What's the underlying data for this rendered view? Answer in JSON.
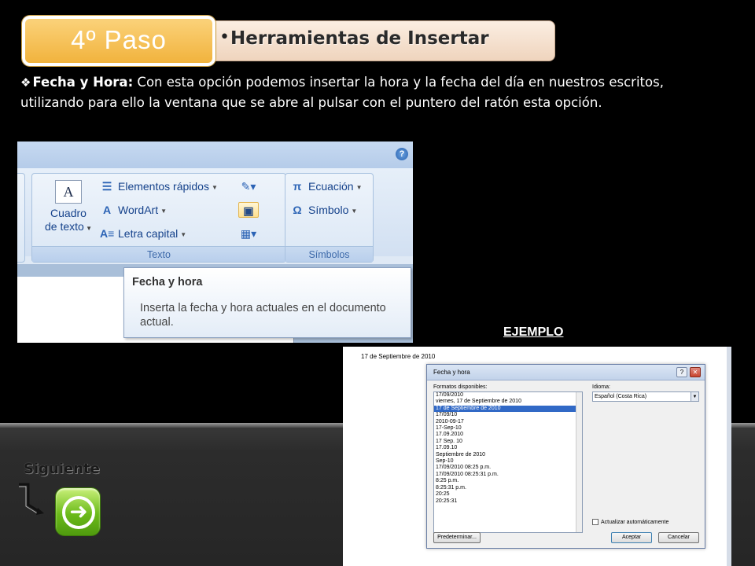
{
  "header": {
    "step_label": "4º Paso",
    "section_title": "Herramientas de Insertar",
    "bullet": "•"
  },
  "intro": {
    "marker": "❖",
    "term": "Fecha y Hora:",
    "text": " Con esta opción podemos insertar la hora y la fecha del día en nuestros escritos, utilizando para ello la ventana que se abre al pulsar con el puntero del ratón esta opción."
  },
  "ribbon": {
    "help_icon": "?",
    "text_group": {
      "caption": "Texto",
      "cuadro_label_1": "Cuadro",
      "cuadro_label_2": "de texto",
      "elementos_rapidos": "Elementos rápidos",
      "wordart": "WordArt",
      "letra_capital": "Letra capital"
    },
    "symbols_group": {
      "caption": "Símbolos",
      "ecuacion": "Ecuación",
      "simbolo": "Símbolo"
    },
    "tooltip": {
      "title": "Fecha y hora",
      "body": "Inserta la fecha y hora actuales en el documento actual."
    }
  },
  "example": {
    "label": "EJEMPLO",
    "document_date": "17 de Septiembre de 2010",
    "dialog": {
      "title": "Fecha y hora",
      "formats_label": "Formatos disponibles:",
      "language_label": "Idioma:",
      "language_value": "Español (Costa Rica)",
      "formats": [
        "17/09/2010",
        "viernes, 17 de Septiembre de 2010",
        "17 de Septiembre de 2010",
        "17/09/10",
        "2010-09-17",
        "17-Sep-10",
        "17.09.2010",
        "17 Sep. 10",
        "17.09.10",
        "Septiembre de 2010",
        "Sep-10",
        "17/09/2010 08:25 p.m.",
        "17/09/2010 08:25:31 p.m.",
        "8:25 p.m.",
        "8:25:31 p.m.",
        "20:25",
        "20:25:31"
      ],
      "selected_index": 2,
      "auto_update_label": "Actualizar automáticamente",
      "default_button": "Predeterminar...",
      "accept_button": "Aceptar",
      "cancel_button": "Cancelar"
    }
  },
  "navigation": {
    "next_label": "Siguiente",
    "next_icon": "arrow-right-icon"
  }
}
